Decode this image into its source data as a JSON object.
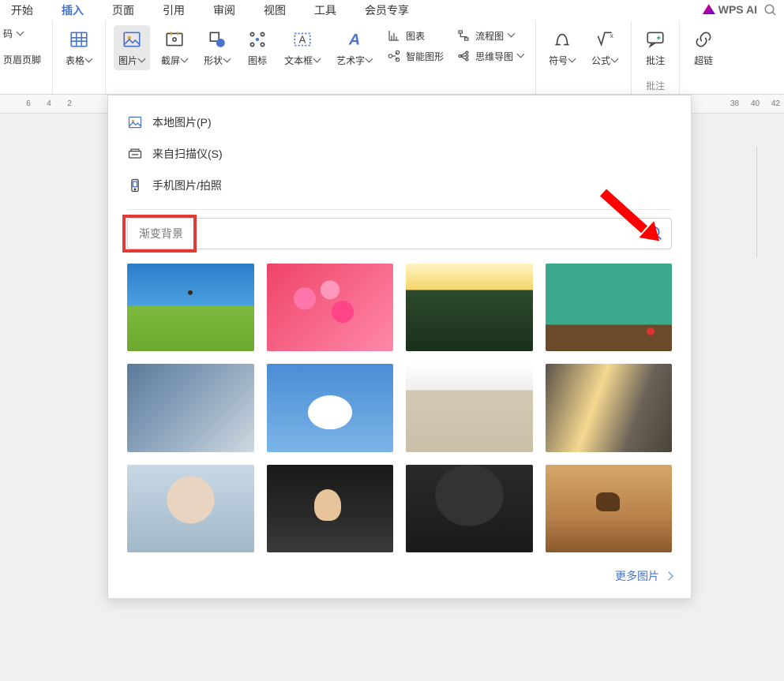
{
  "menubar": {
    "tabs": [
      "开始",
      "插入",
      "页面",
      "引用",
      "审阅",
      "视图",
      "工具",
      "会员专享"
    ],
    "active_index": 1,
    "wps_ai": "WPS AI"
  },
  "ribbon": {
    "header_footer_partial": "页眉页脚",
    "code_partial": "码",
    "table": "表格",
    "picture": "图片",
    "screenshot": "截屏",
    "shape": "形状",
    "icon": "图标",
    "textbox": "文本框",
    "wordart": "艺术字",
    "chart": "图表",
    "flowchart": "流程图",
    "smartart": "智能图形",
    "mindmap": "思维导图",
    "symbol": "符号",
    "equation": "公式",
    "comment": "批注",
    "comment_group": "批注",
    "hyperlink_partial": "超链"
  },
  "ruler_marks": [
    "6",
    "4",
    "2",
    "38",
    "40",
    "42"
  ],
  "dropdown": {
    "local_image": "本地图片(P)",
    "from_scanner": "来自扫描仪(S)",
    "phone_image": "手机图片/拍照",
    "search_placeholder": "渐变背景",
    "more_images": "更多图片"
  }
}
